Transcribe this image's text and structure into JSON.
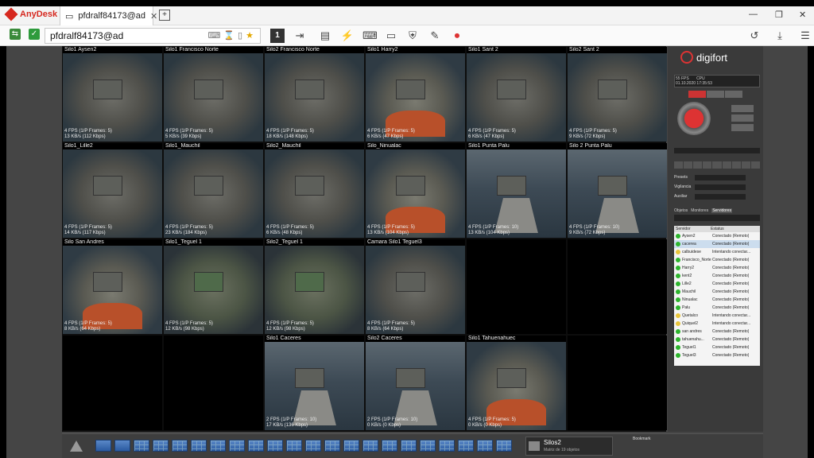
{
  "anydesk": {
    "app_name": "AnyDesk",
    "tab_label": "pfdralf84173@ad",
    "address": "pfdralf84173@ad",
    "active_monitor": "1"
  },
  "brand": {
    "name": "digifort"
  },
  "timeline": {
    "date": "01.10.2020 17:35:53",
    "fps_label": "55 FPS",
    "cpu_label": "CPU"
  },
  "cameras": [
    {
      "title": "Silo1 Aysen2",
      "fps": "4 FPS (1/P Frames: 5)",
      "rate": "13 KB/s (112 Kbps)",
      "scene": "deck"
    },
    {
      "title": "Silo1 Francisco Norte",
      "fps": "4 FPS (1/P Frames: 5)",
      "rate": "5 KB/s (39 Kbps)",
      "scene": "deck"
    },
    {
      "title": "Silo2 Francisco Norte",
      "fps": "4 FPS (1/P Frames: 5)",
      "rate": "18 KB/s (148 Kbps)",
      "scene": "deck"
    },
    {
      "title": "Silo1 Harry2",
      "fps": "4 FPS (1/P Frames: 5)",
      "rate": "6 KB/s (47 Kbps)",
      "scene": "deck-orange"
    },
    {
      "title": "Silo1 Sant 2",
      "fps": "4 FPS (1/P Frames: 5)",
      "rate": "6 KB/s (47 Kbps)",
      "scene": "deck"
    },
    {
      "title": "Silo2 Sant 2",
      "fps": "4 FPS (1/P Frames: 5)",
      "rate": "9 KB/s (72 Kbps)",
      "scene": "deck"
    },
    {
      "title": "Silo1_Lille2",
      "fps": "4 FPS (1/P Frames: 5)",
      "rate": "14 KB/s (117 Kbps)",
      "scene": "deck"
    },
    {
      "title": "Silo1_Mauchil",
      "fps": "4 FPS (1/P Frames: 5)",
      "rate": "23 KB/s (184 Kbps)",
      "scene": "deck"
    },
    {
      "title": "Silo2_Mauchil",
      "fps": "4 FPS (1/P Frames: 5)",
      "rate": "6 KB/s (48 Kbps)",
      "scene": "deck"
    },
    {
      "title": "Silo_Ninualac",
      "fps": "4 FPS (1/P Frames: 5)",
      "rate": "13 KB/s (104 Kbps)",
      "scene": "deck-orange"
    },
    {
      "title": "Silo1 Punta Palu",
      "fps": "4 FPS (1/P Frames: 10)",
      "rate": "13 KB/s (104 Kbps)",
      "scene": "water"
    },
    {
      "title": "Silo 2 Punta Palu",
      "fps": "4 FPS (1/P Frames: 10)",
      "rate": "9 KB/s (72 Kbps)",
      "scene": "water"
    },
    {
      "title": "Silo San Andres",
      "fps": "4 FPS (1/P Frames: 5)",
      "rate": "8 KB/s (64 Kbps)",
      "scene": "deck-orange"
    },
    {
      "title": "Silo1_Teguel 1",
      "fps": "4 FPS (1/P Frames: 5)",
      "rate": "12 KB/s (98 Kbps)",
      "scene": "deck-green"
    },
    {
      "title": "Silo2_Teguel 1",
      "fps": "4 FPS (1/P Frames: 5)",
      "rate": "12 KB/s (98 Kbps)",
      "scene": "deck-green"
    },
    {
      "title": "Camara Silo1 Teguel3",
      "fps": "4 FPS (1/P Frames: 5)",
      "rate": "8 KB/s (64 Kbps)",
      "scene": "deck"
    },
    {
      "title": "",
      "fps": "",
      "rate": "",
      "scene": "empty"
    },
    {
      "title": "",
      "fps": "",
      "rate": "",
      "scene": "empty"
    },
    {
      "title": "",
      "fps": "",
      "rate": "",
      "scene": "empty"
    },
    {
      "title": "",
      "fps": "",
      "rate": "",
      "scene": "empty"
    },
    {
      "title": "Silo1 Caceres",
      "fps": "2 FPS (1/P Frames: 10)",
      "rate": "17 KB/s (136 Kbps)",
      "scene": "water"
    },
    {
      "title": "Silo2 Caceres",
      "fps": "2 FPS (1/P Frames: 10)",
      "rate": "0 KB/s (0 Kbps)",
      "scene": "water"
    },
    {
      "title": "Silo1 Tahuenahuec",
      "fps": "4 FPS (1/P Frames: 5)",
      "rate": "0 KB/s (0 Kbps)",
      "scene": "deck-orange"
    },
    {
      "title": "",
      "fps": "",
      "rate": "",
      "scene": "empty"
    }
  ],
  "panel": {
    "presets_label": "Presets",
    "vigilancia_label": "Vigilancia",
    "auxiliar_label": "Auxiliar",
    "tabs": [
      "Objetos",
      "Monitores",
      "Servidores"
    ],
    "server_head": [
      "Servidor",
      "Estatus"
    ],
    "servers": [
      {
        "name": "Aysen2",
        "status": "Conectado (Remoto)",
        "color": "#2db52d"
      },
      {
        "name": "cacerea",
        "status": "Conectado (Remoto)",
        "color": "#2db52d"
      },
      {
        "name": "calbuidese",
        "status": "Intentando conectar...",
        "color": "#e8c53a"
      },
      {
        "name": "Francisco_Norte",
        "status": "Conectado (Remoto)",
        "color": "#2db52d"
      },
      {
        "name": "Harry2",
        "status": "Conectado (Remoto)",
        "color": "#2db52d"
      },
      {
        "name": "kent2",
        "status": "Conectado (Remoto)",
        "color": "#2db52d"
      },
      {
        "name": "Lille2",
        "status": "Conectado (Remoto)",
        "color": "#2db52d"
      },
      {
        "name": "Mauchil",
        "status": "Conectado (Remoto)",
        "color": "#2db52d"
      },
      {
        "name": "Ninualac",
        "status": "Conectado (Remoto)",
        "color": "#2db52d"
      },
      {
        "name": "Palu",
        "status": "Conectado (Remoto)",
        "color": "#2db52d"
      },
      {
        "name": "Quetalco",
        "status": "Intentando conectar...",
        "color": "#e8c53a"
      },
      {
        "name": "Quiquel2",
        "status": "Intentando conectar...",
        "color": "#e8c53a"
      },
      {
        "name": "san andres",
        "status": "Conectado (Remoto)",
        "color": "#2db52d"
      },
      {
        "name": "tahuenahu...",
        "status": "Conectado (Remoto)",
        "color": "#2db52d"
      },
      {
        "name": "Teguel1",
        "status": "Conectado (Remoto)",
        "color": "#2db52d"
      },
      {
        "name": "Teguel3",
        "status": "Conectado (Remoto)",
        "color": "#2db52d"
      }
    ]
  },
  "bottom": {
    "view_name": "Silos2",
    "view_sub": "Matriz de 19 objetos",
    "bookmark_label": "Bookmark"
  }
}
